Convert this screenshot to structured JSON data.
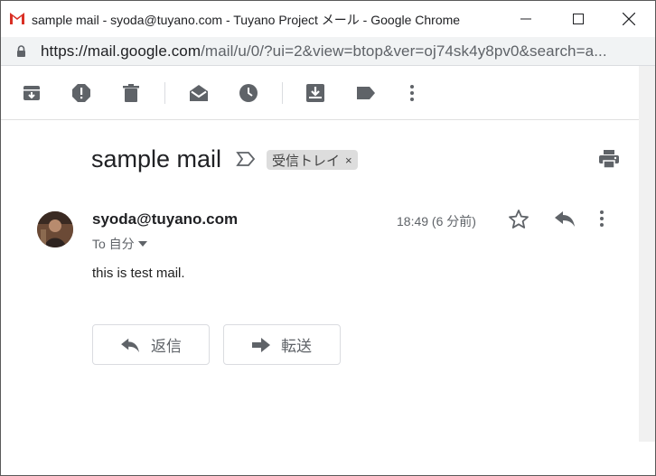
{
  "window": {
    "title": "sample mail - syoda@tuyano.com - Tuyano Project メール - Google Chrome"
  },
  "address_bar": {
    "url_host": "https://mail.google.com",
    "url_rest": "/mail/u/0/?ui=2&view=btop&ver=oj74sk4y8pv0&search=a..."
  },
  "toolbar": {
    "icons": [
      "archive-icon",
      "report-spam-icon",
      "delete-icon",
      "mark-unread-icon",
      "snooze-icon",
      "move-to-inbox-icon",
      "label-icon",
      "more-vert-icon"
    ]
  },
  "message": {
    "subject": "sample mail",
    "label_chip": "受信トレイ",
    "label_chip_close": "×",
    "sender": "syoda@tuyano.com",
    "to_line": "To 自分",
    "time": "18:49 (6 分前)",
    "body": "this is test mail."
  },
  "actions": {
    "reply_label": "返信",
    "forward_label": "転送"
  },
  "colors": {
    "gmail_red": "#d93025",
    "icon_gray": "#5f6368",
    "chip_bg": "#dddddd"
  }
}
